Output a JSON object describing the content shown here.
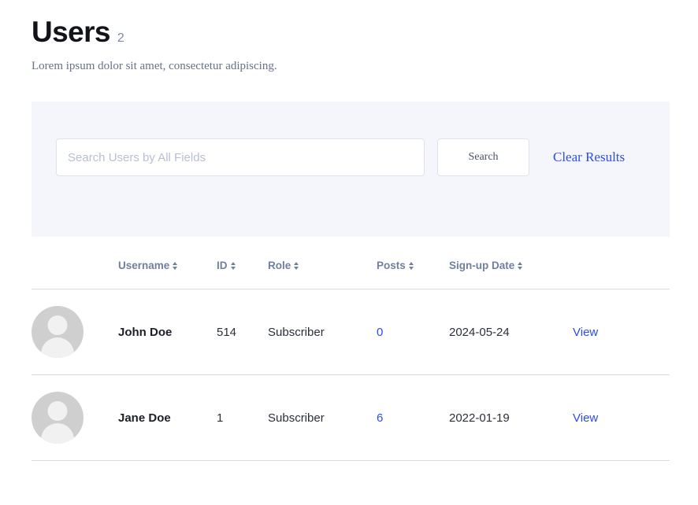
{
  "header": {
    "title": "Users",
    "count": "2",
    "subtitle": "Lorem ipsum dolor sit amet, consectetur adipiscing."
  },
  "search": {
    "placeholder": "Search Users by All Fields",
    "value": "",
    "search_button_label": "Search",
    "clear_link_label": "Clear Results"
  },
  "table": {
    "columns": [
      {
        "key": "avatar",
        "label": ""
      },
      {
        "key": "username",
        "label": "Username"
      },
      {
        "key": "id",
        "label": "ID"
      },
      {
        "key": "role",
        "label": "Role"
      },
      {
        "key": "posts",
        "label": "Posts"
      },
      {
        "key": "date",
        "label": "Sign-up Date"
      },
      {
        "key": "action",
        "label": ""
      }
    ],
    "rows": [
      {
        "username": "John Doe",
        "id": "514",
        "role": "Subscriber",
        "posts": "0",
        "date": "2024-05-24",
        "action": "View"
      },
      {
        "username": "Jane Doe",
        "id": "1",
        "role": "Subscriber",
        "posts": "6",
        "date": "2022-01-19",
        "action": "View"
      }
    ]
  },
  "colors": {
    "link": "#2b4bf2",
    "panel_bg": "#f5f6fb",
    "header_text": "#707f9c",
    "title": "#12141a",
    "divider": "#d8dbe3",
    "avatar_bg": "#cfcfcf"
  },
  "icons": {
    "sort": "sort-ascending-descending-icon"
  }
}
